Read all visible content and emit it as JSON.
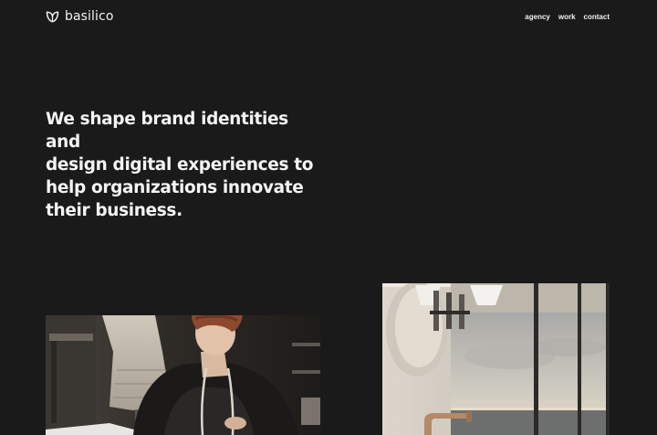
{
  "header": {
    "brand_name": "basilico",
    "brand_icon": "basil-leaf-logo-icon",
    "nav": [
      {
        "label": "agency"
      },
      {
        "label": "work"
      },
      {
        "label": "contact"
      }
    ]
  },
  "hero": {
    "lines": [
      "We shape brand identities and",
      "design digital experiences to",
      "help organizations innovate",
      "their business."
    ]
  },
  "colors": {
    "background": "#1a1a1a",
    "text": "#f4f4f4"
  }
}
